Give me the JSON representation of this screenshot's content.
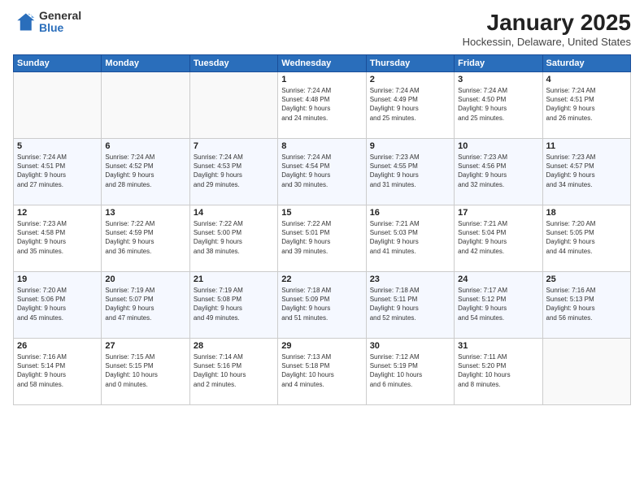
{
  "header": {
    "logo_general": "General",
    "logo_blue": "Blue",
    "month_title": "January 2025",
    "location": "Hockessin, Delaware, United States"
  },
  "days_of_week": [
    "Sunday",
    "Monday",
    "Tuesday",
    "Wednesday",
    "Thursday",
    "Friday",
    "Saturday"
  ],
  "weeks": [
    [
      {
        "day": "",
        "detail": ""
      },
      {
        "day": "",
        "detail": ""
      },
      {
        "day": "",
        "detail": ""
      },
      {
        "day": "1",
        "detail": "Sunrise: 7:24 AM\nSunset: 4:48 PM\nDaylight: 9 hours\nand 24 minutes."
      },
      {
        "day": "2",
        "detail": "Sunrise: 7:24 AM\nSunset: 4:49 PM\nDaylight: 9 hours\nand 25 minutes."
      },
      {
        "day": "3",
        "detail": "Sunrise: 7:24 AM\nSunset: 4:50 PM\nDaylight: 9 hours\nand 25 minutes."
      },
      {
        "day": "4",
        "detail": "Sunrise: 7:24 AM\nSunset: 4:51 PM\nDaylight: 9 hours\nand 26 minutes."
      }
    ],
    [
      {
        "day": "5",
        "detail": "Sunrise: 7:24 AM\nSunset: 4:51 PM\nDaylight: 9 hours\nand 27 minutes."
      },
      {
        "day": "6",
        "detail": "Sunrise: 7:24 AM\nSunset: 4:52 PM\nDaylight: 9 hours\nand 28 minutes."
      },
      {
        "day": "7",
        "detail": "Sunrise: 7:24 AM\nSunset: 4:53 PM\nDaylight: 9 hours\nand 29 minutes."
      },
      {
        "day": "8",
        "detail": "Sunrise: 7:24 AM\nSunset: 4:54 PM\nDaylight: 9 hours\nand 30 minutes."
      },
      {
        "day": "9",
        "detail": "Sunrise: 7:23 AM\nSunset: 4:55 PM\nDaylight: 9 hours\nand 31 minutes."
      },
      {
        "day": "10",
        "detail": "Sunrise: 7:23 AM\nSunset: 4:56 PM\nDaylight: 9 hours\nand 32 minutes."
      },
      {
        "day": "11",
        "detail": "Sunrise: 7:23 AM\nSunset: 4:57 PM\nDaylight: 9 hours\nand 34 minutes."
      }
    ],
    [
      {
        "day": "12",
        "detail": "Sunrise: 7:23 AM\nSunset: 4:58 PM\nDaylight: 9 hours\nand 35 minutes."
      },
      {
        "day": "13",
        "detail": "Sunrise: 7:22 AM\nSunset: 4:59 PM\nDaylight: 9 hours\nand 36 minutes."
      },
      {
        "day": "14",
        "detail": "Sunrise: 7:22 AM\nSunset: 5:00 PM\nDaylight: 9 hours\nand 38 minutes."
      },
      {
        "day": "15",
        "detail": "Sunrise: 7:22 AM\nSunset: 5:01 PM\nDaylight: 9 hours\nand 39 minutes."
      },
      {
        "day": "16",
        "detail": "Sunrise: 7:21 AM\nSunset: 5:03 PM\nDaylight: 9 hours\nand 41 minutes."
      },
      {
        "day": "17",
        "detail": "Sunrise: 7:21 AM\nSunset: 5:04 PM\nDaylight: 9 hours\nand 42 minutes."
      },
      {
        "day": "18",
        "detail": "Sunrise: 7:20 AM\nSunset: 5:05 PM\nDaylight: 9 hours\nand 44 minutes."
      }
    ],
    [
      {
        "day": "19",
        "detail": "Sunrise: 7:20 AM\nSunset: 5:06 PM\nDaylight: 9 hours\nand 45 minutes."
      },
      {
        "day": "20",
        "detail": "Sunrise: 7:19 AM\nSunset: 5:07 PM\nDaylight: 9 hours\nand 47 minutes."
      },
      {
        "day": "21",
        "detail": "Sunrise: 7:19 AM\nSunset: 5:08 PM\nDaylight: 9 hours\nand 49 minutes."
      },
      {
        "day": "22",
        "detail": "Sunrise: 7:18 AM\nSunset: 5:09 PM\nDaylight: 9 hours\nand 51 minutes."
      },
      {
        "day": "23",
        "detail": "Sunrise: 7:18 AM\nSunset: 5:11 PM\nDaylight: 9 hours\nand 52 minutes."
      },
      {
        "day": "24",
        "detail": "Sunrise: 7:17 AM\nSunset: 5:12 PM\nDaylight: 9 hours\nand 54 minutes."
      },
      {
        "day": "25",
        "detail": "Sunrise: 7:16 AM\nSunset: 5:13 PM\nDaylight: 9 hours\nand 56 minutes."
      }
    ],
    [
      {
        "day": "26",
        "detail": "Sunrise: 7:16 AM\nSunset: 5:14 PM\nDaylight: 9 hours\nand 58 minutes."
      },
      {
        "day": "27",
        "detail": "Sunrise: 7:15 AM\nSunset: 5:15 PM\nDaylight: 10 hours\nand 0 minutes."
      },
      {
        "day": "28",
        "detail": "Sunrise: 7:14 AM\nSunset: 5:16 PM\nDaylight: 10 hours\nand 2 minutes."
      },
      {
        "day": "29",
        "detail": "Sunrise: 7:13 AM\nSunset: 5:18 PM\nDaylight: 10 hours\nand 4 minutes."
      },
      {
        "day": "30",
        "detail": "Sunrise: 7:12 AM\nSunset: 5:19 PM\nDaylight: 10 hours\nand 6 minutes."
      },
      {
        "day": "31",
        "detail": "Sunrise: 7:11 AM\nSunset: 5:20 PM\nDaylight: 10 hours\nand 8 minutes."
      },
      {
        "day": "",
        "detail": ""
      }
    ]
  ]
}
